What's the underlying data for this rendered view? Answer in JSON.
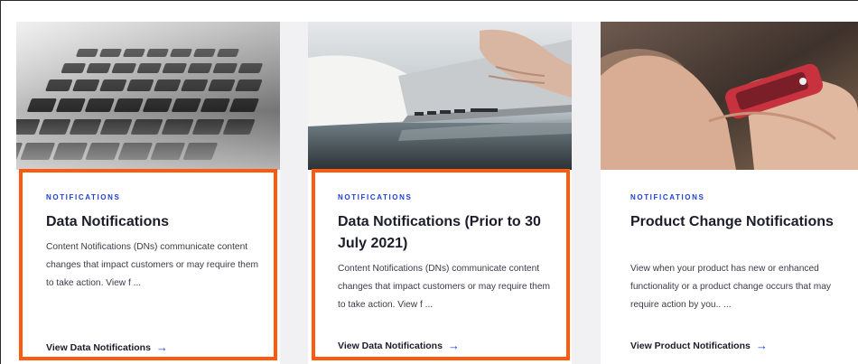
{
  "cards": [
    {
      "tag": "NOTIFICATIONS",
      "title": "Data Notifications",
      "description": "Content Notifications (DNs) communicate content changes that impact customers or may require them to take action. View f ...",
      "link_label": "View Data Notifications",
      "image": "laptop-keyboard-photo",
      "highlighted": true
    },
    {
      "tag": "NOTIFICATIONS",
      "title": "Data Notifications (Prior to 30 July 2021)",
      "description": "Content Notifications (DNs) communicate content changes that impact customers or may require them to take action. View f ...",
      "link_label": "View Data Notifications",
      "image": "hands-typing-laptop-photo",
      "highlighted": true
    },
    {
      "tag": "NOTIFICATIONS",
      "title": "Product Change Notifications",
      "description": "View when your product has new or enhanced functionality or a product change occurs that may require action by you.. ...",
      "link_label": "View Product Notifications",
      "image": "hand-holding-phone-photo",
      "highlighted": false
    }
  ],
  "icons": {
    "link_arrow": "arrow-right-icon",
    "arrow_glyph": "→"
  },
  "colors": {
    "accent": "#1f3fd6",
    "highlight": "#ff5a0d",
    "title": "#1c1c2a"
  }
}
